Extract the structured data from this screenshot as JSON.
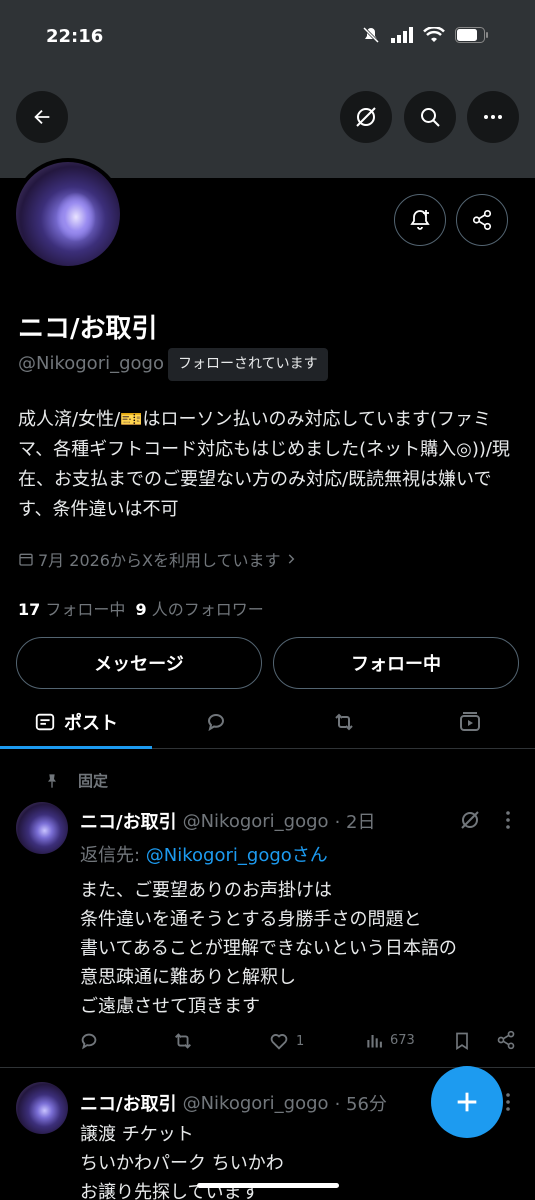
{
  "status_bar": {
    "time": "22:16"
  },
  "header": {
    "back_icon": "arrow-left-icon",
    "grok_icon": "grok-icon",
    "search_icon": "search-icon",
    "more_icon": "more-horizontal-icon"
  },
  "profile": {
    "display_name": "ニコ/お取引",
    "handle": "@Nikogori_gogo",
    "follows_you": "フォローされています",
    "bio": "成人済/女性/🎫はローソン払いのみ対応しています(ファミマ、各種ギフトコード対応もはじめました(ネット購入◎))/現在、お支払までのご要望ない方のみ対応/既読無視は嫌いです、条件違いは不可",
    "joined": "7月 2026からXを利用しています",
    "following_count": "17",
    "following_label": "フォロー中",
    "followers_count": "9",
    "followers_label": "人のフォロワー",
    "message_button": "メッセージ",
    "following_button": "フォロー中"
  },
  "tabs": {
    "posts": "ポスト"
  },
  "pinned_label": "固定",
  "posts": [
    {
      "name": "ニコ/お取引",
      "handle": "@Nikogori_gogo",
      "time": "· 2日",
      "reply_prefix": "返信先: ",
      "reply_target": "@Nikogori_gogoさん",
      "body": "また、ご要望ありのお声掛けは\n条件違いを通そうとする身勝手さの問題と\n書いてあることが理解できないという日本語の\n意思疎通に難ありと解釈し\nご遠慮させて頂きます",
      "likes": "1",
      "views": "673"
    },
    {
      "name": "ニコ/お取引",
      "handle": "@Nikogori_gogo",
      "time": "· 56分",
      "body": "譲渡 チケット\nちいかわパーク ちいかわ\nお譲り先探しています"
    }
  ],
  "colors": {
    "accent": "#1d9bf0",
    "background": "#000000",
    "muted": "#71767b",
    "banner": "#2f3336"
  }
}
